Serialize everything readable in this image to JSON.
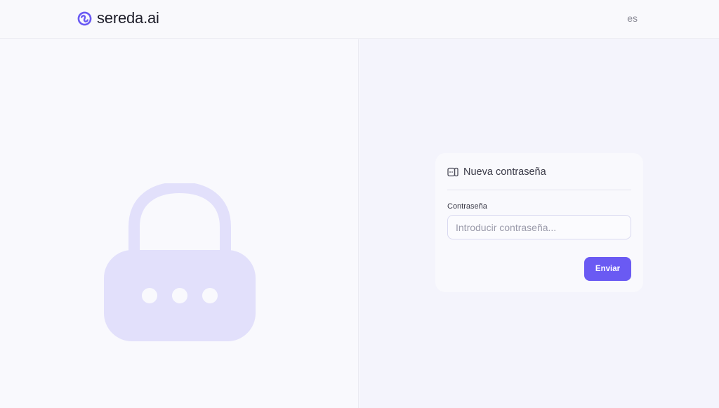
{
  "header": {
    "brand": "sereda.ai",
    "language": "es"
  },
  "card": {
    "title": "Nueva contraseña",
    "password_label": "Contraseña",
    "password_placeholder": "Introducir contraseña...",
    "password_value": "",
    "submit_label": "Enviar"
  },
  "colors": {
    "accent": "#6a5af3",
    "lock_illustration": "#e2e0fb",
    "background": "#f8f8fc"
  },
  "icons": {
    "logo": "sereda-logo-icon",
    "card_title": "password-field-icon",
    "illustration": "lock-icon"
  }
}
